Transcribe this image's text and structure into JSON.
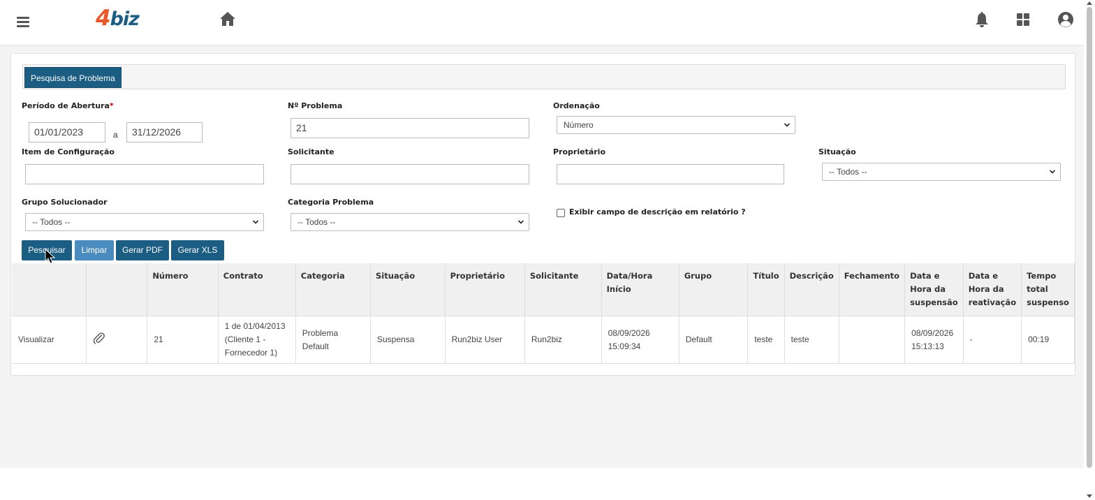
{
  "header": {
    "logo_four": "4",
    "logo_biz": "biz",
    "icons": [
      "menu-icon",
      "home-icon",
      "bell-icon",
      "apps-grid-icon",
      "user-icon"
    ]
  },
  "tab": {
    "label": "Pesquisa de Problema"
  },
  "form": {
    "periodo_label": "Período de Abertura",
    "required_mark": "*",
    "date_from": "01/01/2023",
    "date_sep": "a",
    "date_to": "31/12/2026",
    "num_problema_label": "Nº Problema",
    "num_problema_value": "21",
    "ordenacao_label": "Ordenação",
    "ordenacao_value": "Número",
    "item_config_label": "Item de Configuração",
    "item_config_value": "",
    "solicitante_label": "Solicitante",
    "solicitante_value": "",
    "proprietario_label": "Proprietário",
    "proprietario_value": "",
    "situacao_label": "Situação",
    "situacao_value": "-- Todos --",
    "grupo_label": "Grupo Solucionador",
    "grupo_value": "-- Todos --",
    "categoria_label": "Categoria Problema",
    "categoria_value": "-- Todos --",
    "exibir_label": "Exibir campo de descrição em relatório ?",
    "exibir_checked": false
  },
  "buttons": {
    "pesquisar": "Pesquisar",
    "limpar": "Limpar",
    "gerar_pdf": "Gerar PDF",
    "gerar_xls": "Gerar XLS"
  },
  "table": {
    "headers": [
      "",
      "",
      "Número",
      "Contrato",
      "Categoria",
      "Situação",
      "Proprietário",
      "Solicitante",
      "Data/Hora Início",
      "Grupo",
      "Título",
      "Descrição",
      "Fechamento",
      "Data e Hora da suspensão",
      "Data e Hora da reativação",
      "Tempo total suspenso"
    ],
    "rows": [
      {
        "action": "Visualizar",
        "numero": "21",
        "contrato": "1 de 01/04/2013 (Cliente 1 - Fornecedor 1)",
        "categoria": "Problema Default",
        "situacao": "Suspensa",
        "proprietario": "Run2biz User",
        "solicitante": "Run2biz",
        "data_inicio": "08/09/2026 15:09:34",
        "grupo": "Default",
        "titulo": "teste",
        "descricao": "teste",
        "fechamento": "",
        "data_suspensao": "08/09/2026 15:13:13",
        "data_reativacao": "-",
        "tempo_suspenso": "00:19"
      }
    ]
  },
  "colors": {
    "primary": "#1b5d83",
    "primary_light": "#4a8bc0",
    "logo_orange": "#e8582a"
  }
}
